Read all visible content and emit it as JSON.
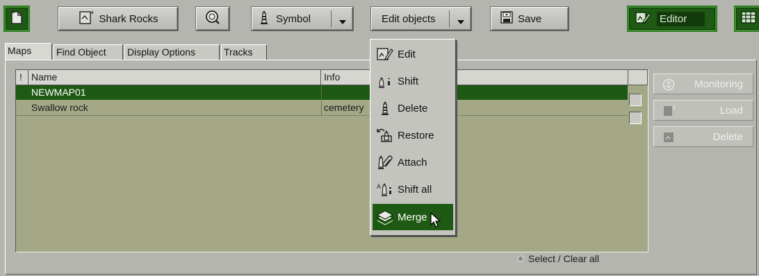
{
  "toolbar": {
    "map_button_label": "Shark Rocks",
    "symbol_label": "Symbol",
    "edit_objects_label": "Edit objects",
    "save_label": "Save",
    "editor_label": "Editor"
  },
  "tabs": [
    {
      "label": "Maps",
      "active": true
    },
    {
      "label": "Find Object",
      "active": false
    },
    {
      "label": "Display Options",
      "active": false
    },
    {
      "label": "Tracks",
      "active": false
    }
  ],
  "table": {
    "columns": {
      "flag": "!",
      "name": "Name",
      "info": "Info"
    },
    "rows": [
      {
        "name": "NEWMAP01",
        "info": "",
        "selected": true
      },
      {
        "name": "Swallow rock",
        "info": "cemetery",
        "selected": false
      }
    ]
  },
  "side": {
    "monitoring": "Monitoring",
    "load": "Load",
    "delete": "Delete"
  },
  "select_clear_label": "Select / Clear all",
  "edit_menu": {
    "items": [
      {
        "label": "Edit",
        "icon": "edit-icon"
      },
      {
        "label": "Shift",
        "icon": "shift-icon"
      },
      {
        "label": "Delete",
        "icon": "delete-icon"
      },
      {
        "label": "Restore",
        "icon": "restore-icon"
      },
      {
        "label": "Attach",
        "icon": "attach-icon"
      },
      {
        "label": "Shift all",
        "icon": "shift-all-icon"
      },
      {
        "label": "Merge",
        "icon": "merge-icon",
        "highlighted": true
      }
    ]
  },
  "colors": {
    "highlight": "#1e5a14",
    "list_bg": "#a4a887",
    "background": "#b5b5b0"
  }
}
